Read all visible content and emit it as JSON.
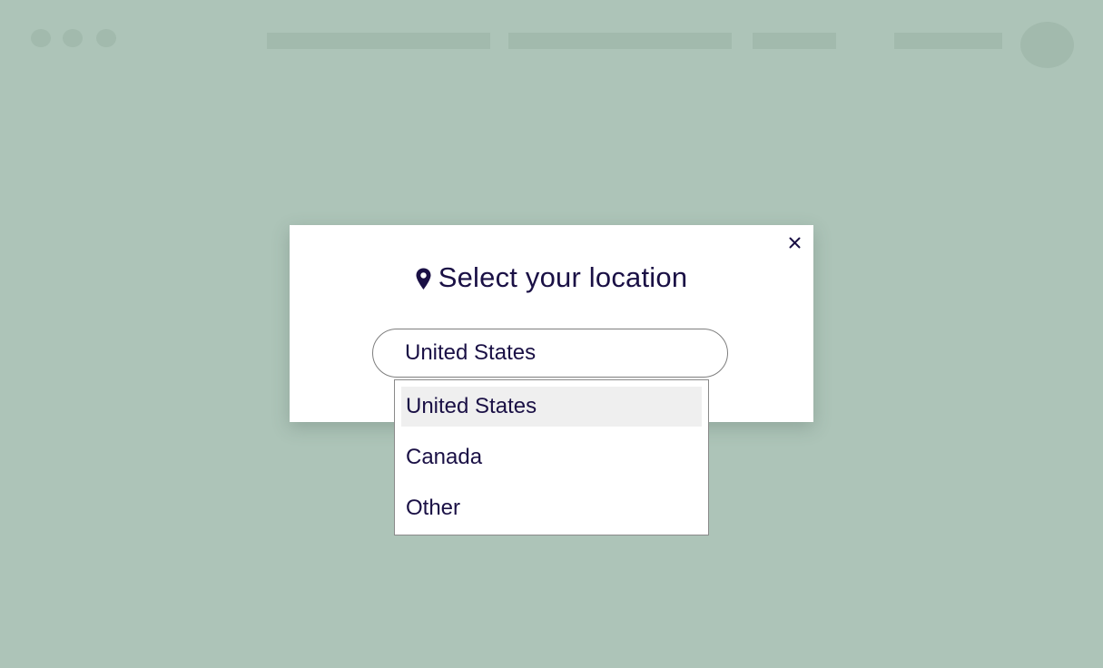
{
  "modal": {
    "title": "Select your location",
    "title_icon": "map-pin-icon",
    "close_icon": "close-icon",
    "select": {
      "value": "United States"
    },
    "options": [
      {
        "label": "United States",
        "selected": true
      },
      {
        "label": "Canada",
        "selected": false
      },
      {
        "label": "Other",
        "selected": false
      }
    ]
  },
  "colors": {
    "backdrop": "#adc4b8",
    "text": "#1a1045",
    "highlight": "#efefef"
  }
}
